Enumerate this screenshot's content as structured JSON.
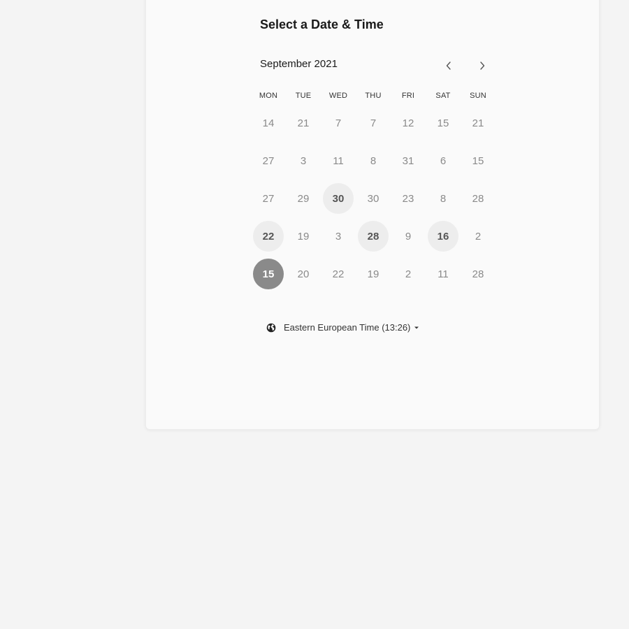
{
  "header": {
    "title": "Select a Date & Time"
  },
  "calendar": {
    "month_label": "September 2021",
    "prev_icon": "chevron-left-icon",
    "next_icon": "chevron-right-icon",
    "weekdays": [
      "MON",
      "TUE",
      "WED",
      "THU",
      "FRI",
      "SAT",
      "SUN"
    ],
    "weeks": [
      [
        {
          "label": "14",
          "state": "disabled"
        },
        {
          "label": "21",
          "state": "disabled"
        },
        {
          "label": "7",
          "state": "disabled"
        },
        {
          "label": "7",
          "state": "disabled"
        },
        {
          "label": "12",
          "state": "disabled"
        },
        {
          "label": "15",
          "state": "disabled"
        },
        {
          "label": "21",
          "state": "disabled"
        }
      ],
      [
        {
          "label": "27",
          "state": "disabled"
        },
        {
          "label": "3",
          "state": "disabled"
        },
        {
          "label": "11",
          "state": "disabled"
        },
        {
          "label": "8",
          "state": "disabled"
        },
        {
          "label": "31",
          "state": "disabled"
        },
        {
          "label": "6",
          "state": "disabled"
        },
        {
          "label": "15",
          "state": "disabled"
        }
      ],
      [
        {
          "label": "27",
          "state": "disabled"
        },
        {
          "label": "29",
          "state": "disabled"
        },
        {
          "label": "30",
          "state": "available"
        },
        {
          "label": "30",
          "state": "disabled"
        },
        {
          "label": "23",
          "state": "disabled"
        },
        {
          "label": "8",
          "state": "disabled"
        },
        {
          "label": "28",
          "state": "disabled"
        }
      ],
      [
        {
          "label": "22",
          "state": "available"
        },
        {
          "label": "19",
          "state": "disabled"
        },
        {
          "label": "3",
          "state": "disabled"
        },
        {
          "label": "28",
          "state": "available"
        },
        {
          "label": "9",
          "state": "disabled"
        },
        {
          "label": "16",
          "state": "available"
        },
        {
          "label": "2",
          "state": "disabled"
        }
      ],
      [
        {
          "label": "15",
          "state": "selected"
        },
        {
          "label": "20",
          "state": "disabled"
        },
        {
          "label": "22",
          "state": "disabled"
        },
        {
          "label": "19",
          "state": "disabled"
        },
        {
          "label": "2",
          "state": "disabled"
        },
        {
          "label": "11",
          "state": "disabled"
        },
        {
          "label": "28",
          "state": "disabled"
        }
      ]
    ]
  },
  "timezone": {
    "icon": "globe-icon",
    "label": "Eastern European Time (13:26)",
    "caret_icon": "caret-down-icon"
  },
  "colors": {
    "page_bg": "#f4f4f4",
    "card_bg": "#fafafa",
    "available_bg": "#ededed",
    "selected_bg": "#8a8a8a",
    "disabled_text": "#8a8a8a"
  }
}
